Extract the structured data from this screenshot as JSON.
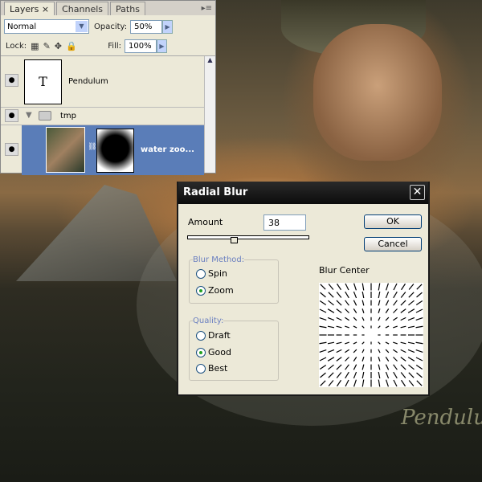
{
  "layers_panel": {
    "tabs": [
      "Layers",
      "Channels",
      "Paths"
    ],
    "tab_close": "×",
    "menu_icon": "panel-menu-icon",
    "blend_mode": "Normal",
    "opacity_label": "Opacity:",
    "opacity": "50%",
    "lock_label": "Lock:",
    "fill_label": "Fill:",
    "fill": "100%",
    "layers": [
      {
        "name": "Pendulum",
        "thumb": "T"
      },
      {
        "name": "tmp"
      },
      {
        "name": "water zoo..."
      }
    ],
    "selected_color": "#5a7db8"
  },
  "dialog": {
    "title": "Radial Blur",
    "amount_label": "Amount",
    "amount": "38",
    "amount_fraction": 0.38,
    "ok": "OK",
    "cancel": "Cancel",
    "blur_method_label": "Blur Method:",
    "methods": [
      "Spin",
      "Zoom"
    ],
    "method_selected": "Zoom",
    "quality_label": "Quality:",
    "qualities": [
      "Draft",
      "Good",
      "Best"
    ],
    "quality_selected": "Good",
    "blur_center_label": "Blur Center"
  },
  "watermark": "Pendulu"
}
